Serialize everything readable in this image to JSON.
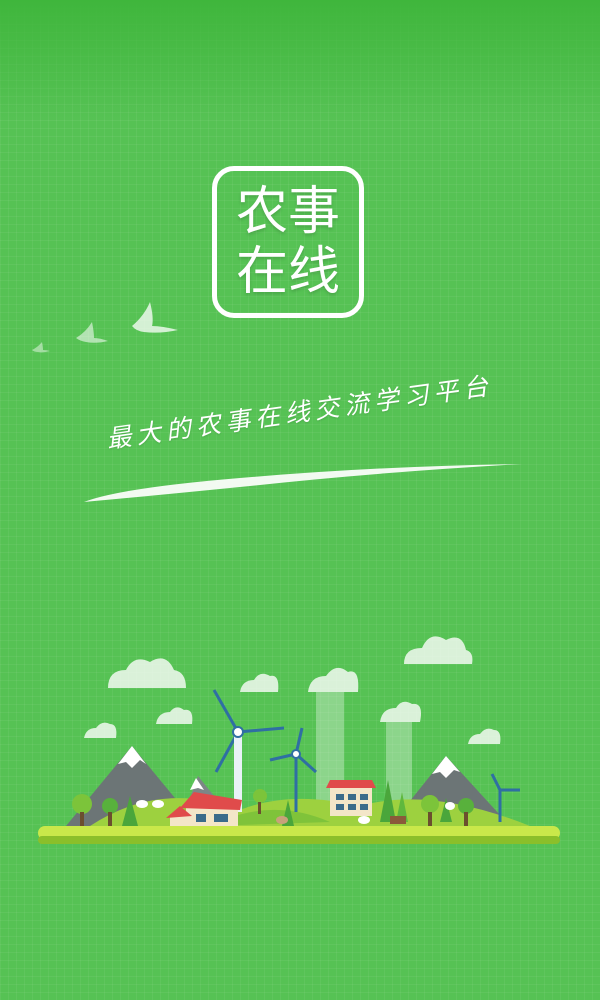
{
  "app": {
    "logo_lines": [
      "农事",
      "在线"
    ],
    "slogan": "最大的农事在线交流学习平台"
  },
  "colors": {
    "background": "#56c254",
    "logo_border": "#ffffff",
    "ground": "#c9e84a"
  },
  "decor": {
    "birds_icon": "birds-icon",
    "illustration": "farm-landscape-illustration"
  }
}
